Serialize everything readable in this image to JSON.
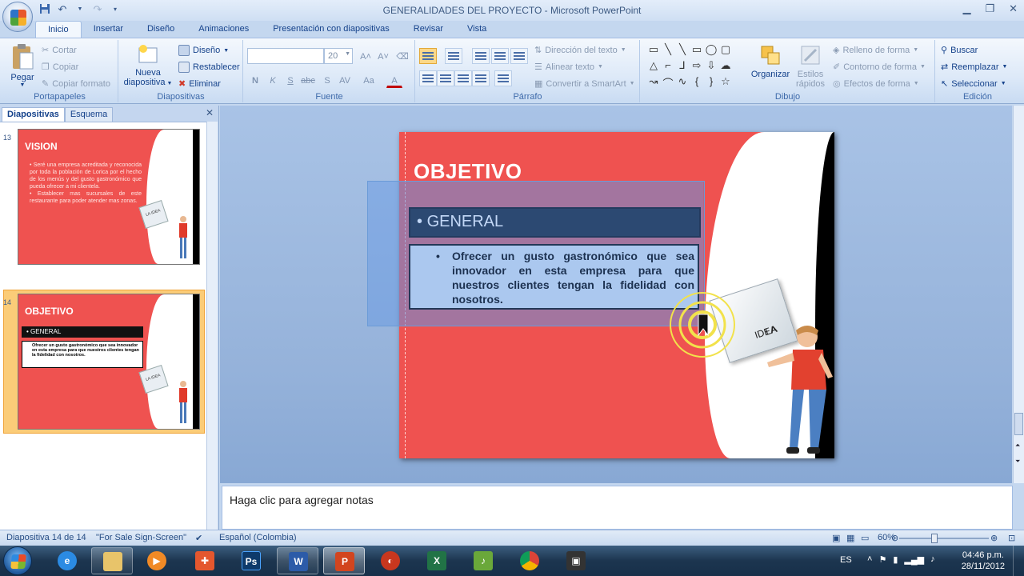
{
  "window": {
    "title_doc": "GENERALIDADES DEL PROYECTO",
    "title_sep": " - ",
    "title_app": "Microsoft PowerPoint"
  },
  "tabs": [
    "Inicio",
    "Insertar",
    "Diseño",
    "Animaciones",
    "Presentación con diapositivas",
    "Revisar",
    "Vista"
  ],
  "ribbon": {
    "clipboard": {
      "paste": "Pegar",
      "cut": "Cortar",
      "copy": "Copiar",
      "format_painter": "Copiar formato",
      "label": "Portapapeles"
    },
    "slides": {
      "new_slide_1": "Nueva",
      "new_slide_2": "diapositiva",
      "layout": "Diseño",
      "reset": "Restablecer",
      "delete": "Eliminar",
      "label": "Diapositivas"
    },
    "font": {
      "size": "20",
      "label": "Fuente",
      "bold": "N",
      "italic": "K",
      "underline": "S",
      "strike": "abc",
      "shadow": "S",
      "spacing": "AV",
      "case": "Aa",
      "color": "A"
    },
    "paragraph": {
      "text_direction": "Dirección del texto",
      "align_text": "Alinear texto",
      "smartart": "Convertir a SmartArt",
      "label": "Párrafo"
    },
    "drawing": {
      "arrange": "Organizar",
      "quick_styles_1": "Estilos",
      "quick_styles_2": "rápidos",
      "fill": "Relleno de forma",
      "outline": "Contorno de forma",
      "effects": "Efectos de forma",
      "label": "Dibujo"
    },
    "editing": {
      "find": "Buscar",
      "replace": "Reemplazar",
      "select": "Seleccionar",
      "label": "Edición"
    }
  },
  "left_pane": {
    "tab_slides": "Diapositivas",
    "tab_outline": "Esquema",
    "slides": [
      {
        "number": "13",
        "title": "VISION",
        "bullets": [
          "Seré una empresa acreditada y reconocida por toda la población de Lorica por el hecho de los menús y del gusto gastronómico que pueda ofrecer a mi clientela.",
          "Establecer mas sucursales de este restaurante para poder atender mas zonas."
        ],
        "card": "LA IDEA"
      },
      {
        "number": "14",
        "title": "OBJETIVO",
        "heading": "GENERAL",
        "body": "Ofrecer un gusto gastronómico que sea innovador en esta empresa para que nuestros clientes tengan la fidelidad con nosotros.",
        "card": "LA IDEA"
      }
    ]
  },
  "slide": {
    "title": "OBJETIVO",
    "heading": "GENERAL",
    "body": "Ofrecer un gusto gastronómico que sea innovador en esta empresa para que nuestros clientes tengan la fidelidad con nosotros.",
    "card_line1": "LA",
    "card_line2": "IDEA"
  },
  "notes": {
    "placeholder": "Haga clic para agregar notas"
  },
  "status": {
    "slide_pos": "Diapositiva 14 de 14",
    "theme": "\"For Sale Sign-Screen\"",
    "language": "Español (Colombia)",
    "zoom": "60%"
  },
  "taskbar": {
    "lang": "ES",
    "time": "04:46 p.m.",
    "date": "28/11/2012"
  },
  "colors": {
    "slide_red": "#ef5250",
    "ribbon_blue": "#15428b"
  }
}
